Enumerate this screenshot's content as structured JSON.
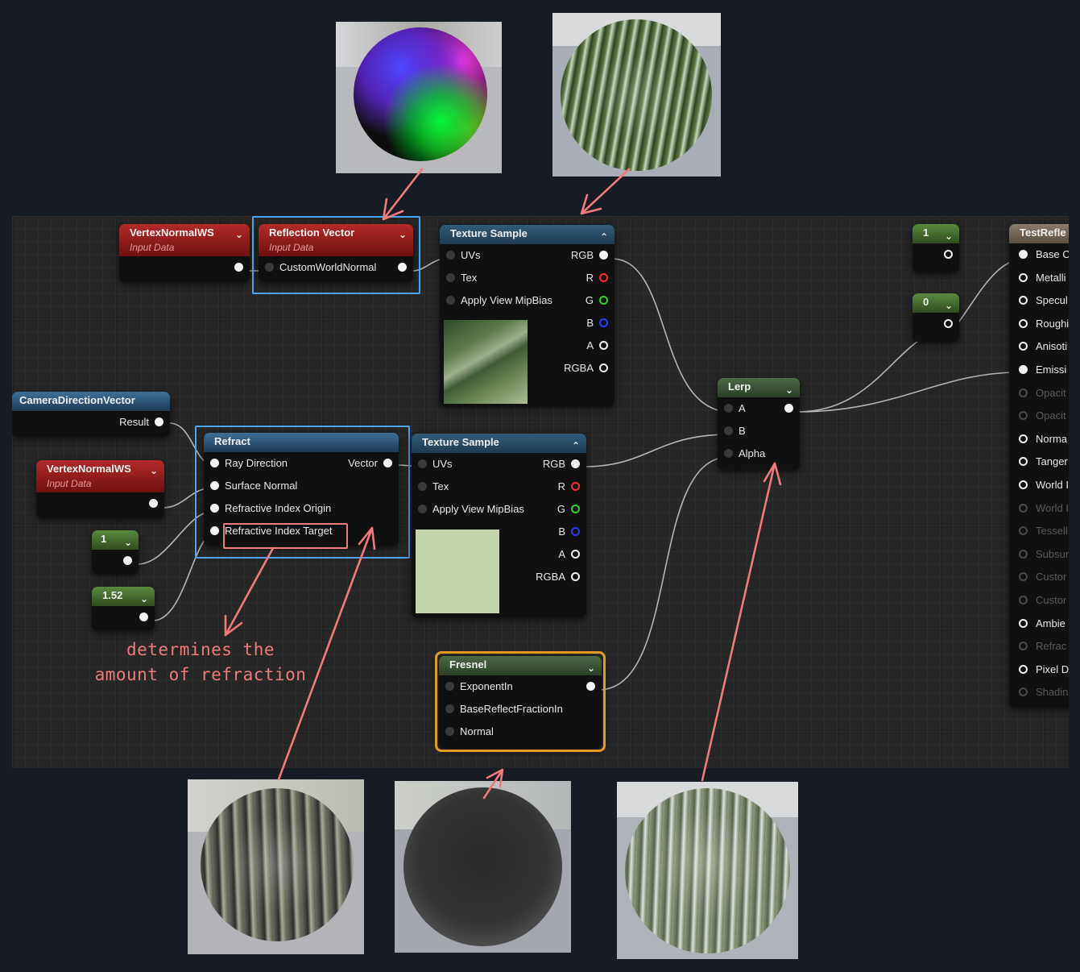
{
  "nodes": {
    "vertex_normal_top": {
      "title": "VertexNormalWS",
      "subtitle": "Input Data"
    },
    "reflection_vector": {
      "title": "Reflection Vector",
      "subtitle": "Input Data",
      "pin_custom": "CustomWorldNormal"
    },
    "texture_sample_top": {
      "title": "Texture Sample",
      "inputs": [
        "UVs",
        "Tex",
        "Apply View MipBias"
      ],
      "outputs": [
        "RGB",
        "R",
        "G",
        "B",
        "A",
        "RGBA"
      ]
    },
    "camera_direction": {
      "title": "CameraDirectionVector",
      "output": "Result"
    },
    "vertex_normal_left": {
      "title": "VertexNormalWS",
      "subtitle": "Input Data"
    },
    "const_1": {
      "value": "1"
    },
    "const_152": {
      "value": "1.52"
    },
    "refract": {
      "title": "Refract",
      "inputs": [
        "Ray Direction",
        "Surface Normal",
        "Refractive Index Origin",
        "Refractive Index Target"
      ],
      "output": "Vector"
    },
    "texture_sample_mid": {
      "title": "Texture Sample",
      "inputs": [
        "UVs",
        "Tex",
        "Apply View MipBias"
      ],
      "outputs": [
        "RGB",
        "R",
        "G",
        "B",
        "A",
        "RGBA"
      ]
    },
    "fresnel": {
      "title": "Fresnel",
      "inputs": [
        "ExponentIn",
        "BaseReflectFractionIn",
        "Normal"
      ]
    },
    "lerp": {
      "title": "Lerp",
      "inputs": [
        "A",
        "B",
        "Alpha"
      ]
    },
    "const_top_1": {
      "value": "1"
    },
    "const_top_0": {
      "value": "0"
    },
    "material_output": {
      "title": "TestRefle",
      "pins": [
        "Base C",
        "Metalli",
        "Specul",
        "Roughi",
        "Anisoti",
        "Emissi",
        "Opacit",
        "Opacit",
        "Norma",
        "Tanger",
        "World I",
        "World I",
        "Tessell",
        "Subsur",
        "Custor",
        "Custor",
        "Ambie",
        "Refrac",
        "Pixel D",
        "Shadin"
      ]
    }
  },
  "annotation": {
    "line1": "determines the",
    "line2": "amount of refraction"
  },
  "colors": {
    "highlight_blue": "#4aa4f0",
    "highlight_red": "#f07b7b",
    "highlight_orange": "#e49a1e",
    "background": "#171b24"
  }
}
